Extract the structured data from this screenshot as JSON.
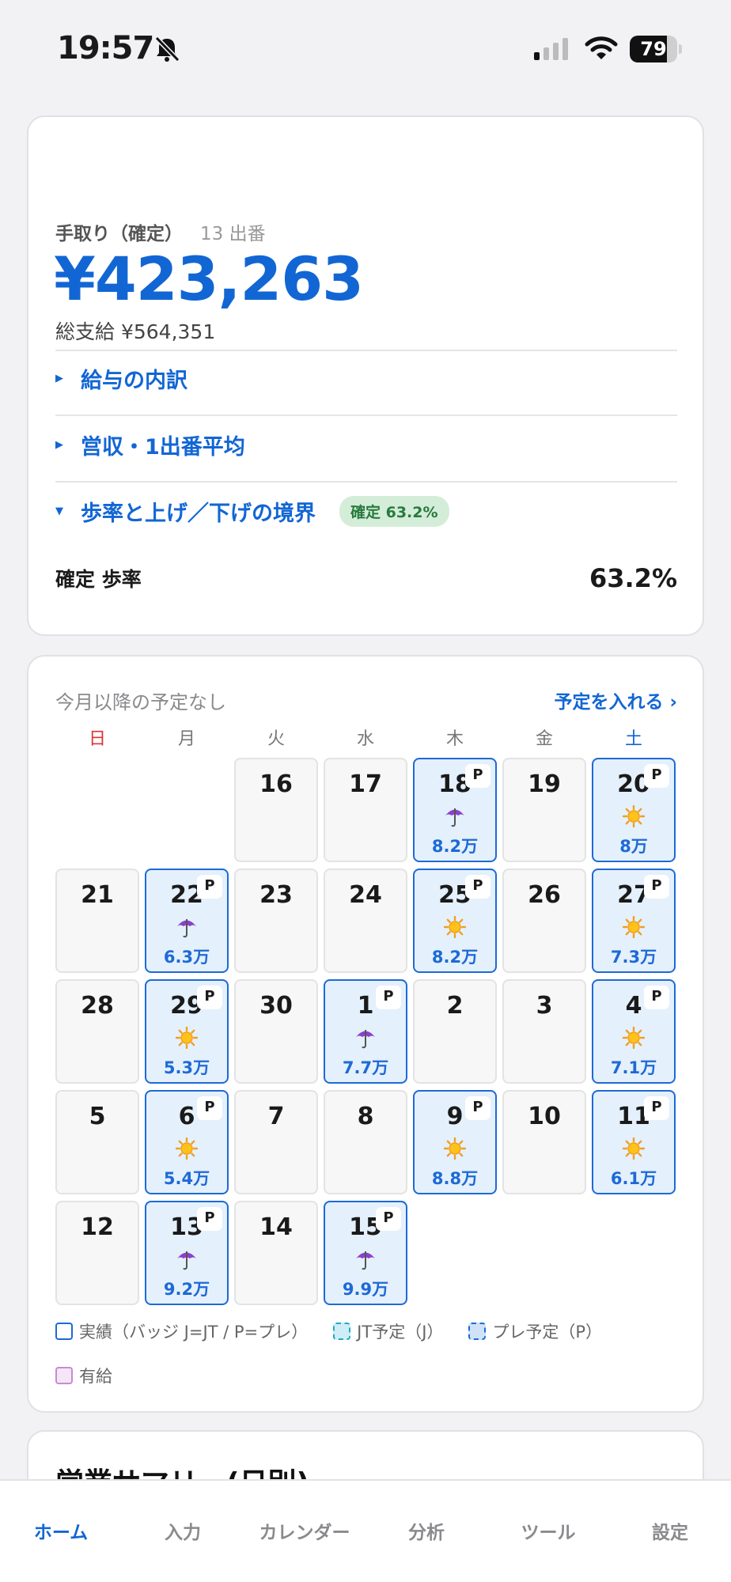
{
  "status_bar": {
    "time": "19:57",
    "battery": "79",
    "battery_level": 0.79
  },
  "summary": {
    "take_home_label": "手取り（確定）",
    "shift_count": "13 出番",
    "take_home_amount": "¥423,263",
    "gross_label": "総支給 ¥564,351",
    "sections": [
      {
        "label": "給与の内訳",
        "expanded": false
      },
      {
        "label": "営収・1出番平均",
        "expanded": false
      },
      {
        "label": "歩率と上げ／下げの境界",
        "expanded": true,
        "badge": "確定 63.2%"
      }
    ],
    "ratio_label": "確定 歩率",
    "ratio_value": "63.2%"
  },
  "calendar": {
    "note": "今月以降の予定なし",
    "add_link": "予定を入れる ›",
    "weekdays": [
      "日",
      "月",
      "火",
      "水",
      "木",
      "金",
      "土"
    ],
    "cells": [
      {
        "day": "16"
      },
      {
        "day": "17"
      },
      {
        "day": "18",
        "badge": "P",
        "weather": "umbrella",
        "amount": "8.2万"
      },
      {
        "day": "19"
      },
      {
        "day": "20",
        "badge": "P",
        "weather": "sun",
        "amount": "8万"
      },
      {
        "day": "21"
      },
      {
        "day": "22",
        "badge": "P",
        "weather": "umbrella",
        "amount": "6.3万"
      },
      {
        "day": "23"
      },
      {
        "day": "24"
      },
      {
        "day": "25",
        "badge": "P",
        "weather": "sun",
        "amount": "8.2万"
      },
      {
        "day": "26"
      },
      {
        "day": "27",
        "badge": "P",
        "weather": "sun",
        "amount": "7.3万"
      },
      {
        "day": "28"
      },
      {
        "day": "29",
        "badge": "P",
        "weather": "sun",
        "amount": "5.3万"
      },
      {
        "day": "30"
      },
      {
        "day": "1",
        "badge": "P",
        "weather": "umbrella",
        "amount": "7.7万"
      },
      {
        "day": "2"
      },
      {
        "day": "3"
      },
      {
        "day": "4",
        "badge": "P",
        "weather": "sun",
        "amount": "7.1万"
      },
      {
        "day": "5"
      },
      {
        "day": "6",
        "badge": "P",
        "weather": "sun",
        "amount": "5.4万"
      },
      {
        "day": "7"
      },
      {
        "day": "8"
      },
      {
        "day": "9",
        "badge": "P",
        "weather": "sun",
        "amount": "8.8万"
      },
      {
        "day": "10"
      },
      {
        "day": "11",
        "badge": "P",
        "weather": "sun",
        "amount": "6.1万"
      },
      {
        "day": "12"
      },
      {
        "day": "13",
        "badge": "P",
        "weather": "umbrella",
        "amount": "9.2万"
      },
      {
        "day": "14"
      },
      {
        "day": "15",
        "badge": "P",
        "weather": "umbrella",
        "amount": "9.9万"
      }
    ],
    "legend": [
      "実績（バッジ J=JT / P=プレ）",
      "JT予定（J）",
      "プレ予定（P）",
      "有給"
    ]
  },
  "daily_summary_title": "営業サマリー(日別)",
  "tabs": [
    "ホーム",
    "入力",
    "カレンダー",
    "分析",
    "ツール",
    "設定"
  ],
  "colors": {
    "accent": "#1266d4",
    "planned_bg": "#e4f0fc",
    "badge_green": "#287a3e"
  }
}
